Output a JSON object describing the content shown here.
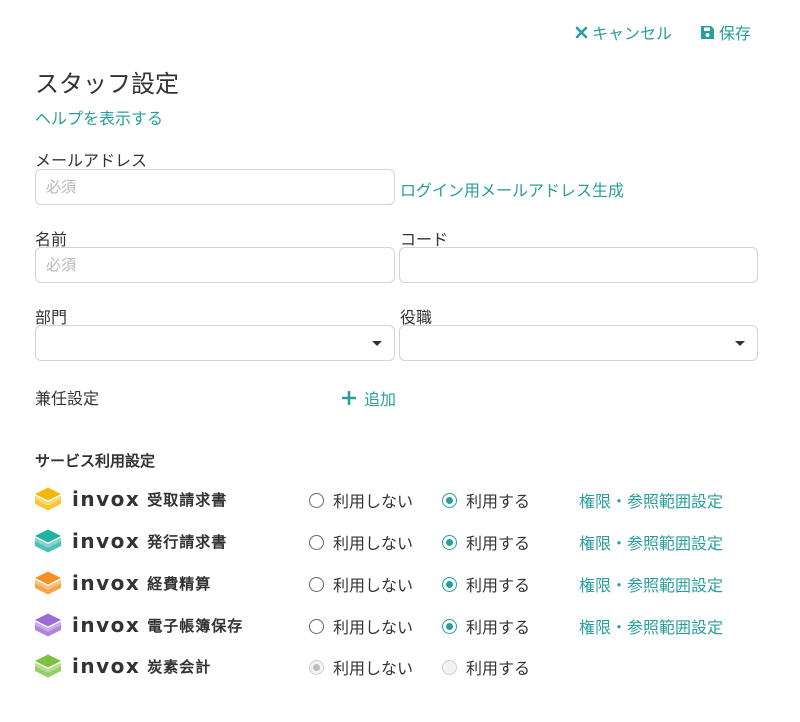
{
  "header": {
    "cancel_label": "キャンセル",
    "save_label": "保存"
  },
  "page": {
    "title": "スタッフ設定",
    "help_link": "ヘルプを表示する"
  },
  "form": {
    "email_label": "メールアドレス",
    "email_placeholder": "必須",
    "email_generate_link": "ログイン用メールアドレス生成",
    "name_label": "名前",
    "name_placeholder": "必須",
    "code_label": "コード",
    "department_label": "部門",
    "position_label": "役職",
    "concurrent_label": "兼任設定",
    "add_label": "追加"
  },
  "services": {
    "section_title": "サービス利用設定",
    "brand": "invox",
    "off_label": "利用しない",
    "on_label": "利用する",
    "permission_link": "権限・参照範囲設定",
    "items": [
      {
        "name": "受取請求書",
        "color": "#f5b800",
        "selected": "on",
        "disabled": false
      },
      {
        "name": "発行請求書",
        "color": "#1bb3a3",
        "selected": "on",
        "disabled": false
      },
      {
        "name": "経費精算",
        "color": "#f2911b",
        "selected": "on",
        "disabled": false
      },
      {
        "name": "電子帳簿保存",
        "color": "#9b6ad6",
        "selected": "on",
        "disabled": false
      },
      {
        "name": "炭素会計",
        "color": "#7cc242",
        "selected": "off",
        "disabled": true
      }
    ]
  },
  "colors": {
    "accent": "#2a9d9e",
    "text": "#333333",
    "border": "#d4d4d4"
  }
}
